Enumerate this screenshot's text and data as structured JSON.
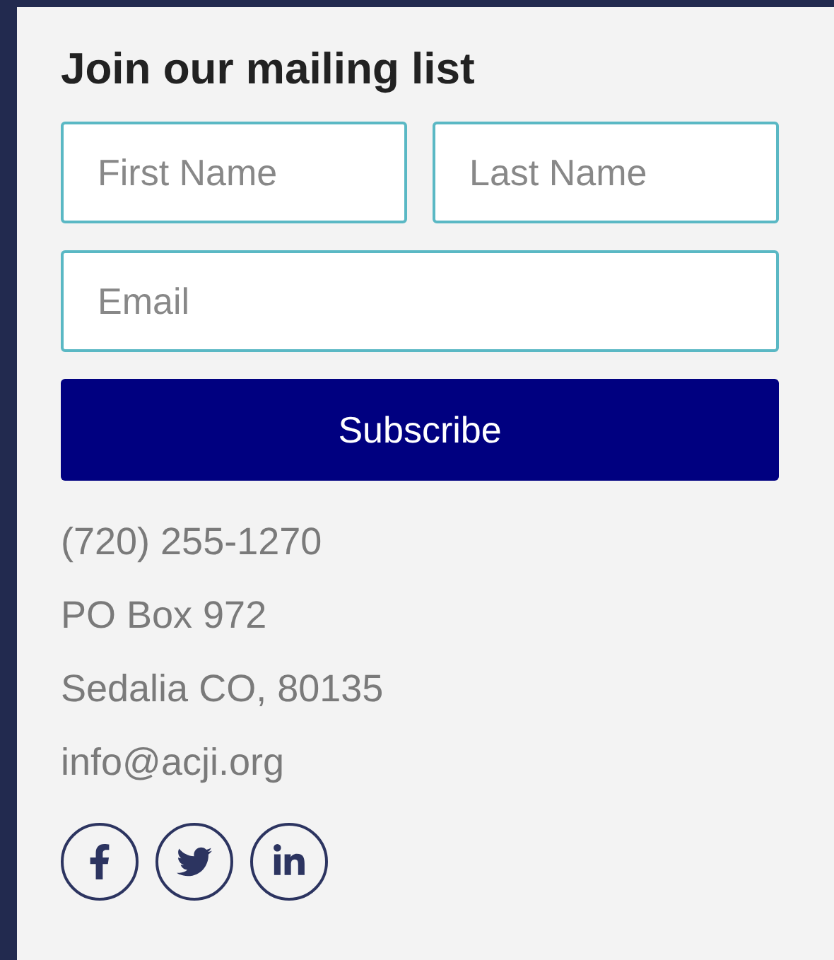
{
  "heading": "Join our mailing list",
  "fields": [
    {
      "placeholder": "First Name"
    },
    {
      "placeholder": "Last Name"
    },
    {
      "placeholder": "Email"
    }
  ],
  "button": "Subscribe",
  "contact": [
    "(720) 255-1270",
    "PO Box 972",
    "Sedalia CO, 80135",
    "info@acji.org"
  ],
  "social": [
    {
      "kind": "facebook"
    },
    {
      "kind": "twitter"
    },
    {
      "kind": "linkedin"
    }
  ]
}
